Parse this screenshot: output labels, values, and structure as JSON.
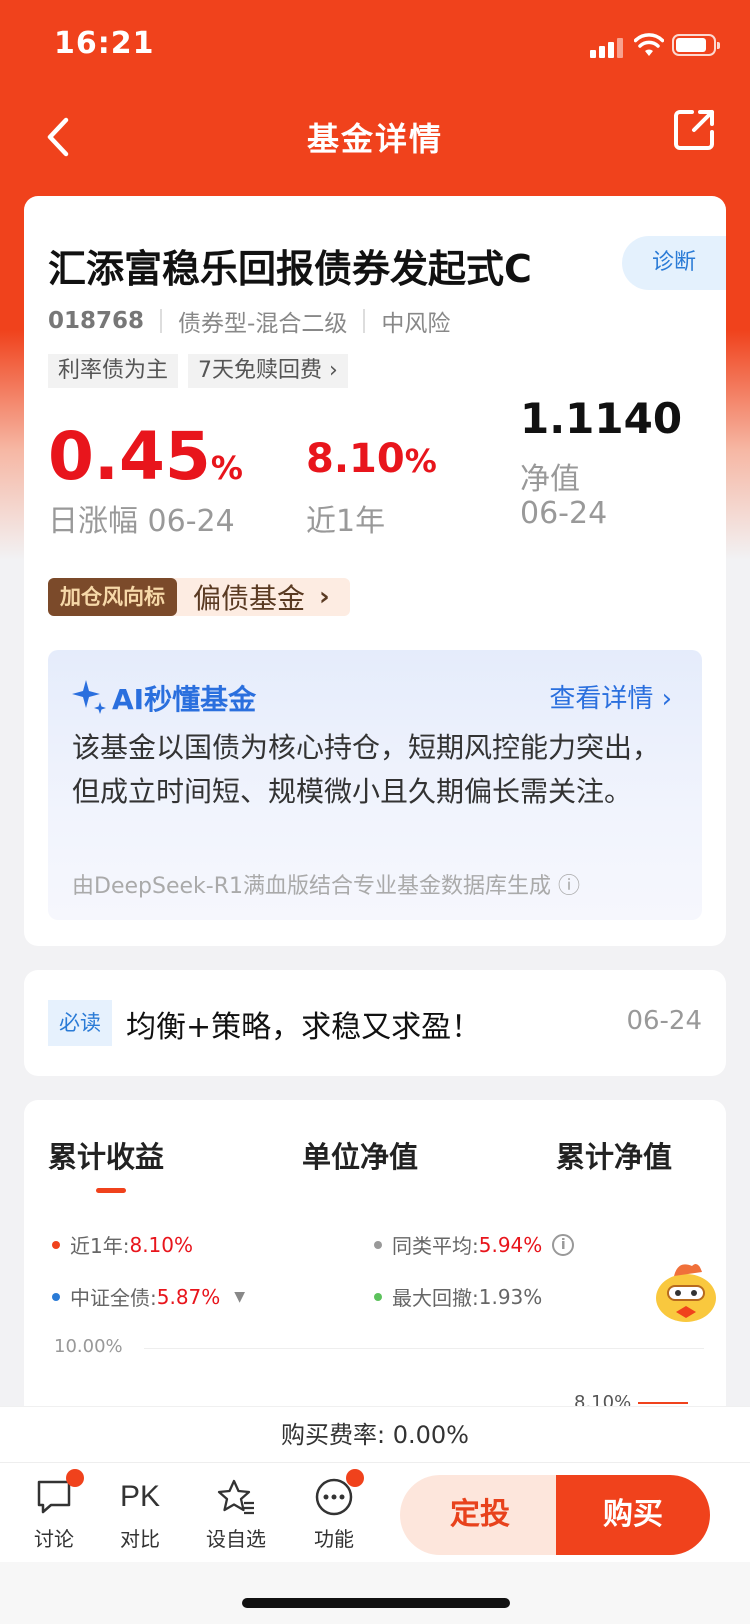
{
  "status": {
    "time": "16:21"
  },
  "nav": {
    "title": "基金详情"
  },
  "fund": {
    "name": "汇添富稳乐回报债券发起式C",
    "diagnose_label": "诊断",
    "code": "018768",
    "type": "债券型-混合二级",
    "risk": "中风险",
    "tags": [
      "利率债为主",
      "7天免赎回费 ›"
    ],
    "daily_change_value": "0.45",
    "daily_change_unit": "%",
    "daily_change_label": "日涨幅 06-24",
    "year_return_value": "8.10",
    "year_return_unit": "%",
    "year_return_label": "近1年",
    "nav_value": "1.1140",
    "nav_label": "净值",
    "nav_date": "06-24",
    "banner_badge": "加仓风向标",
    "banner_text": "偏债基金"
  },
  "ai": {
    "title": "AI秒懂基金",
    "link": "查看详情 ›",
    "text": "该基金以国债为核心持仓，短期风控能力突出，但成立时间短、规模微小且久期偏长需关注。",
    "footnote": "由DeepSeek-R1满血版结合专业基金数据库生成 ⓘ"
  },
  "news": {
    "tag": "必读",
    "text": "均衡+策略，求稳又求盈！",
    "date": "06-24"
  },
  "chart_tabs": [
    "累计收益",
    "单位净值",
    "累计净值"
  ],
  "legend": {
    "year_label": "近1年:",
    "year_value": "8.10%",
    "avg_label": "同类平均:",
    "avg_value": "5.94%",
    "index_label": "中证全债:",
    "index_value": "5.87%",
    "drawdown_label": "最大回撤:",
    "drawdown_value": "1.93%"
  },
  "chart": {
    "y_top_label": "10.00%",
    "end_label": "8.10%"
  },
  "fee": {
    "text": "购买费率: 0.00%"
  },
  "toolbar": {
    "discuss": "讨论",
    "pk_icon_text": "PK",
    "compare": "对比",
    "watchlist": "设自选",
    "functions": "功能",
    "sip": "定投",
    "buy": "购买"
  },
  "colors": {
    "brand": "#f0421c",
    "rise": "#e8151c",
    "link_blue": "#2a6fde"
  }
}
